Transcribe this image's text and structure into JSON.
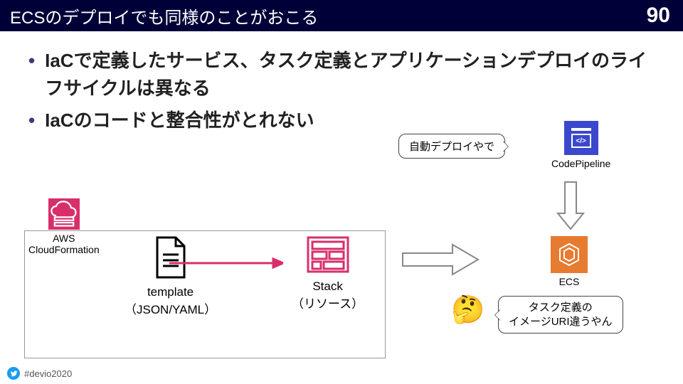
{
  "header": {
    "title": "ECSのデプロイでも同様のことがおこる",
    "page": "90"
  },
  "bullets": [
    "IaCで定義したサービス、タスク定義とアプリケーションデプロイのライフサイクルは異なる",
    "IaCのコードと整合性がとれない"
  ],
  "labels": {
    "cloudformation": "AWS\nCloudFormation",
    "template": "template\n（JSON/YAML）",
    "stack": "Stack\n（リソース）",
    "codepipeline": "CodePipeline",
    "ecs": "ECS"
  },
  "bubbles": {
    "auto_deploy": "自動デプロイやで",
    "image_uri_line1": "タスク定義の",
    "image_uri_line2": "イメージURI違うやん"
  },
  "footer": {
    "hashtag": "#devio2020"
  }
}
